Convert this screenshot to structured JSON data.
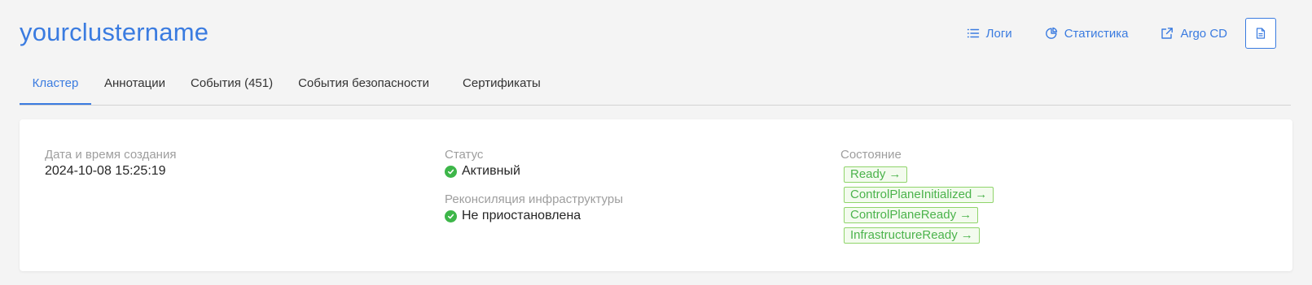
{
  "page_title": "yourclustername",
  "actions": {
    "logs_label": "Логи",
    "stats_label": "Статистика",
    "argocd_label": "Argo CD"
  },
  "tabs": [
    {
      "label": "Кластер",
      "active": true
    },
    {
      "label": "Аннотации",
      "active": false
    },
    {
      "label": "События (451)",
      "active": false
    },
    {
      "label": "События безопасности",
      "active": false
    },
    {
      "label": "Сертификаты",
      "active": false
    }
  ],
  "details": {
    "created_label": "Дата и время создания",
    "created_value": "2024-10-08 15:25:19",
    "status_label": "Статус",
    "status_value": "Активный",
    "reconcile_label": "Реконсиляция инфраструктуры",
    "reconcile_value": "Не приостановлена",
    "conditions_label": "Состояние",
    "conditions": [
      "Ready",
      "ControlPlaneInitialized",
      "ControlPlaneReady",
      "InfrastructureReady"
    ]
  },
  "colors": {
    "accent": "#3a7be0",
    "success": "#3db649",
    "condition_border": "#8fd46a"
  }
}
